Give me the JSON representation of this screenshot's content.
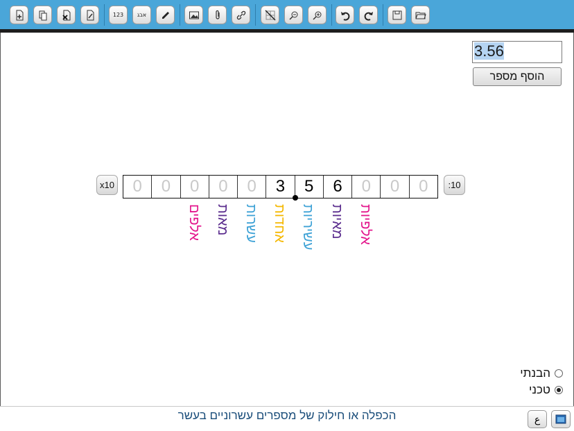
{
  "toolbar": {
    "buttons": [
      {
        "name": "new-page-icon"
      },
      {
        "name": "copy-page-icon"
      },
      {
        "name": "delete-page-icon"
      },
      {
        "name": "edit-page-icon"
      },
      {
        "name": "numbers-tool",
        "label": "123"
      },
      {
        "name": "letters-tool",
        "label": "אבג"
      },
      {
        "name": "pencil-icon"
      },
      {
        "name": "image-icon"
      },
      {
        "name": "attachment-icon"
      },
      {
        "name": "link-icon"
      },
      {
        "name": "hide-grid-icon"
      },
      {
        "name": "zoom-out-icon"
      },
      {
        "name": "zoom-in-icon"
      },
      {
        "name": "undo-icon"
      },
      {
        "name": "redo-icon"
      },
      {
        "name": "save-icon"
      },
      {
        "name": "open-folder-icon"
      }
    ]
  },
  "input": {
    "value": "3.56",
    "add_button_label": "הוסף מספר"
  },
  "place_value": {
    "multiply_label": "x10",
    "divide_label": ":10",
    "digits": [
      "0",
      "0",
      "0",
      "0",
      "0",
      "3",
      "5",
      "6",
      "0",
      "0",
      "0"
    ],
    "labels": [
      {
        "text": "אלפים",
        "color": "#e3168c"
      },
      {
        "text": "מאות",
        "color": "#5b2d8e"
      },
      {
        "text": "עשרות",
        "color": "#3ea2d6"
      },
      {
        "text": "אחדות",
        "color": "#f5b800"
      },
      {
        "text": "עשיריות",
        "color": "#3ea2d6"
      },
      {
        "text": "מאיות",
        "color": "#5b2d8e"
      },
      {
        "text": "אלפיות",
        "color": "#e3168c"
      }
    ]
  },
  "mode": {
    "options": [
      {
        "label": "הבנתי",
        "selected": false
      },
      {
        "label": "טכני",
        "selected": true
      }
    ]
  },
  "footer": {
    "title": "הכפלה או חילוק של מספרים עשרוניים בעשר",
    "lang_button": "ع"
  }
}
